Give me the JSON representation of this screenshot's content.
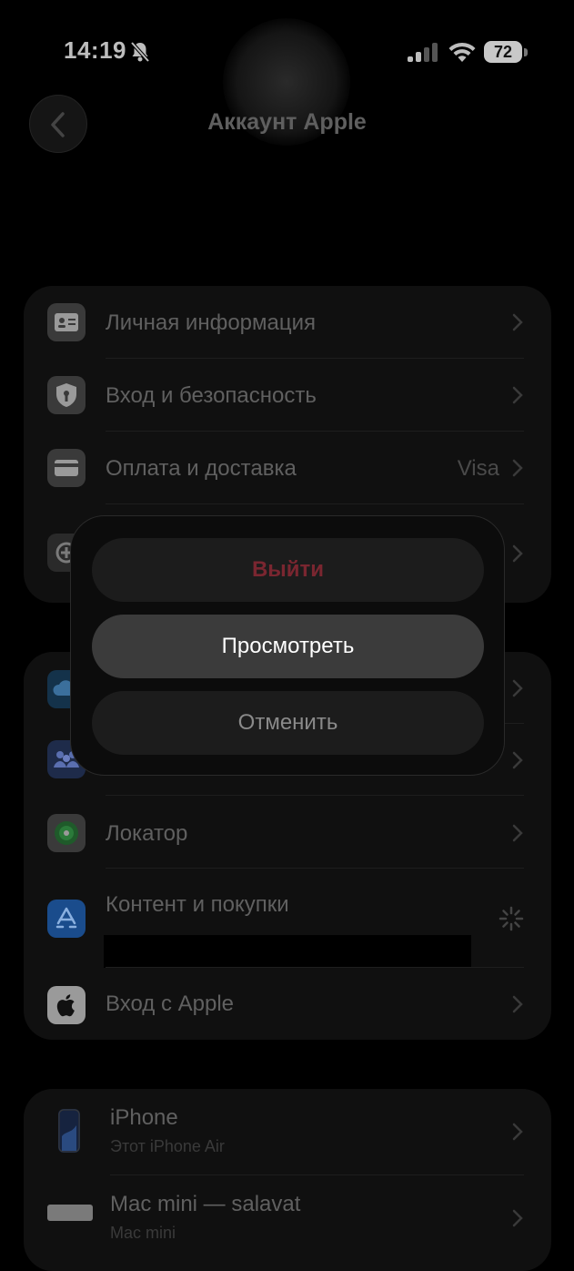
{
  "status_bar": {
    "time": "14:19",
    "battery": "72"
  },
  "nav": {
    "title": "Аккаунт Apple"
  },
  "group1": {
    "items": [
      {
        "label": "Личная информация",
        "icon": "id-card-icon"
      },
      {
        "label": "Вход и безопасность",
        "icon": "shield-icon"
      },
      {
        "label": "Оплата и доставка",
        "value": "Visa",
        "icon": "credit-card-icon"
      },
      {
        "label": "",
        "icon": "subscriptions-icon"
      }
    ]
  },
  "group2": {
    "items": [
      {
        "label": "",
        "icon": "icloud-icon"
      },
      {
        "label": "",
        "value": "",
        "icon": "family-icon"
      },
      {
        "label": "Локатор",
        "icon": "find-my-icon"
      },
      {
        "label": "Контент и покупки",
        "icon": "app-store-icon"
      },
      {
        "label": "Вход с Apple",
        "icon": "apple-icon"
      }
    ]
  },
  "devices": {
    "items": [
      {
        "name": "iPhone",
        "detail": "Этот iPhone Air",
        "icon": "iphone-icon"
      },
      {
        "name": "Mac mini — salavat",
        "detail": "Mac mini",
        "icon": "mac-mini-icon"
      }
    ]
  },
  "dialog": {
    "exit_label": "Выйти",
    "view_label": "Просмотреть",
    "cancel_label": "Отменить"
  },
  "colors": {
    "background": "#000000",
    "group": "#101010",
    "destructive": "#7a2630",
    "dialog_highlight": "#3b3b3b"
  }
}
